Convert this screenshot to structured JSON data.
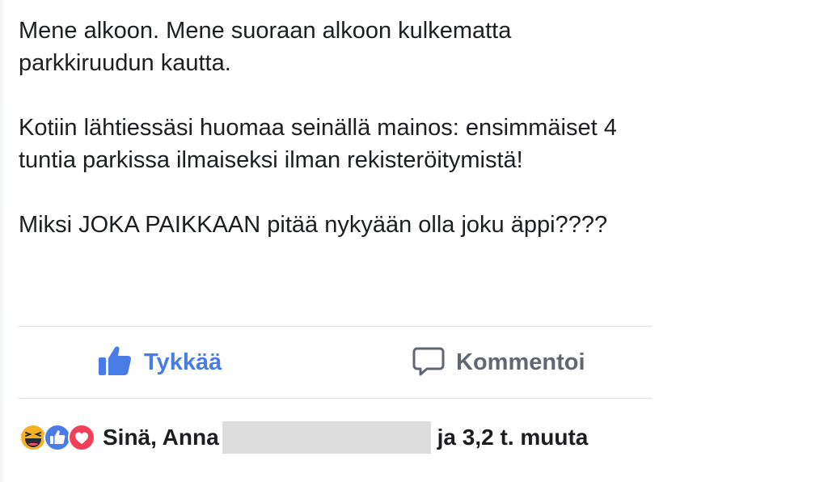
{
  "post": {
    "paragraphs": [
      "Mene alkoon. Mene suoraan alkoon kulkematta parkkiruudun kautta.",
      "Kotiin lähtiessäsi huomaa seinällä mainos: ensimmäiset 4 tuntia parkissa ilmaiseksi ilman rekisteröitymistä!",
      "Miksi JOKA PAIKKAAN pitää nykyään olla joku äppi????"
    ]
  },
  "actions": {
    "like_label": "Tykkää",
    "comment_label": "Kommentoi"
  },
  "reactions": {
    "icons": [
      "haha-icon",
      "like-reaction-icon",
      "love-icon"
    ],
    "names": "Sinä, Anna",
    "others": "ja 3,2 t. muuta"
  },
  "colors": {
    "like_blue": "#4a7ce8",
    "text": "#1c1e21",
    "muted": "#606770",
    "divider": "#dadde1",
    "love_red": "#f33e58",
    "haha_yellow": "#f7b125"
  }
}
